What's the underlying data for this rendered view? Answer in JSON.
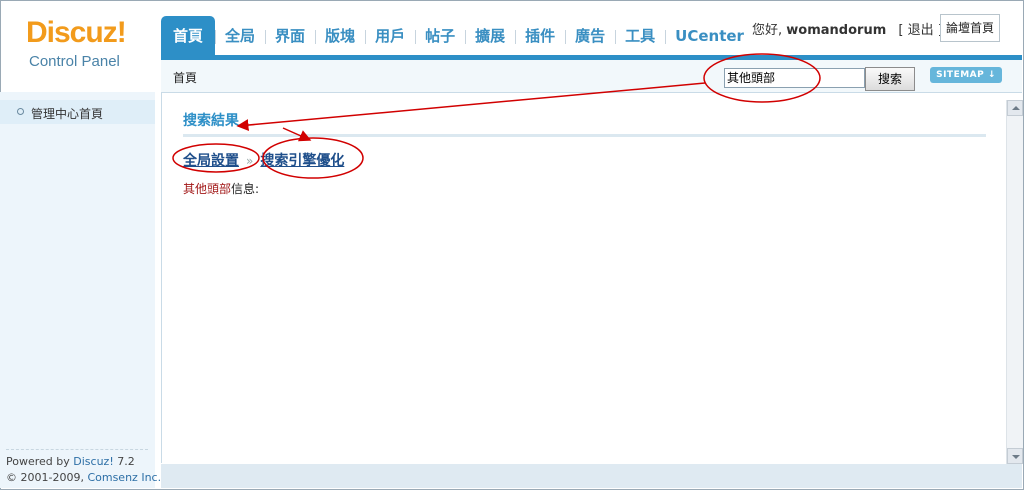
{
  "logo": {
    "title": "Discuz!",
    "subtitle": "Control Panel"
  },
  "nav": {
    "tabs": [
      {
        "label": "首頁",
        "active": true
      },
      {
        "label": "全局"
      },
      {
        "label": "界面"
      },
      {
        "label": "版塊"
      },
      {
        "label": "用戶"
      },
      {
        "label": "帖子"
      },
      {
        "label": "擴展"
      },
      {
        "label": "插件"
      },
      {
        "label": "廣告"
      },
      {
        "label": "工具"
      },
      {
        "label": "UCenter"
      }
    ]
  },
  "user": {
    "greeting": "您好,",
    "name": "womandorum",
    "logout": "[ 退出 ]",
    "forum_home": "論壇首頁"
  },
  "subbar": {
    "breadcrumb": "首頁",
    "search_value": "其他頭部",
    "search_button": "搜索",
    "sitemap": "SITEMAP ↓"
  },
  "sidebar": {
    "items": [
      {
        "label": "管理中心首頁"
      }
    ]
  },
  "footer": {
    "powered_prefix": "Powered by ",
    "powered_link": "Discuz!",
    "version": " 7.2",
    "copyright_prefix": "© 2001-2009, ",
    "copyright_link": "Comsenz Inc."
  },
  "main": {
    "result_title": "搜索結果",
    "path": {
      "parent": "全局設置",
      "separator": "»",
      "current": "搜索引擎優化"
    },
    "info": {
      "highlight": "其他頭部",
      "suffix": "信息:"
    }
  },
  "colors": {
    "accent": "#2d8fc7",
    "logo_orange": "#f29b1c",
    "annotation": "#d10000"
  }
}
